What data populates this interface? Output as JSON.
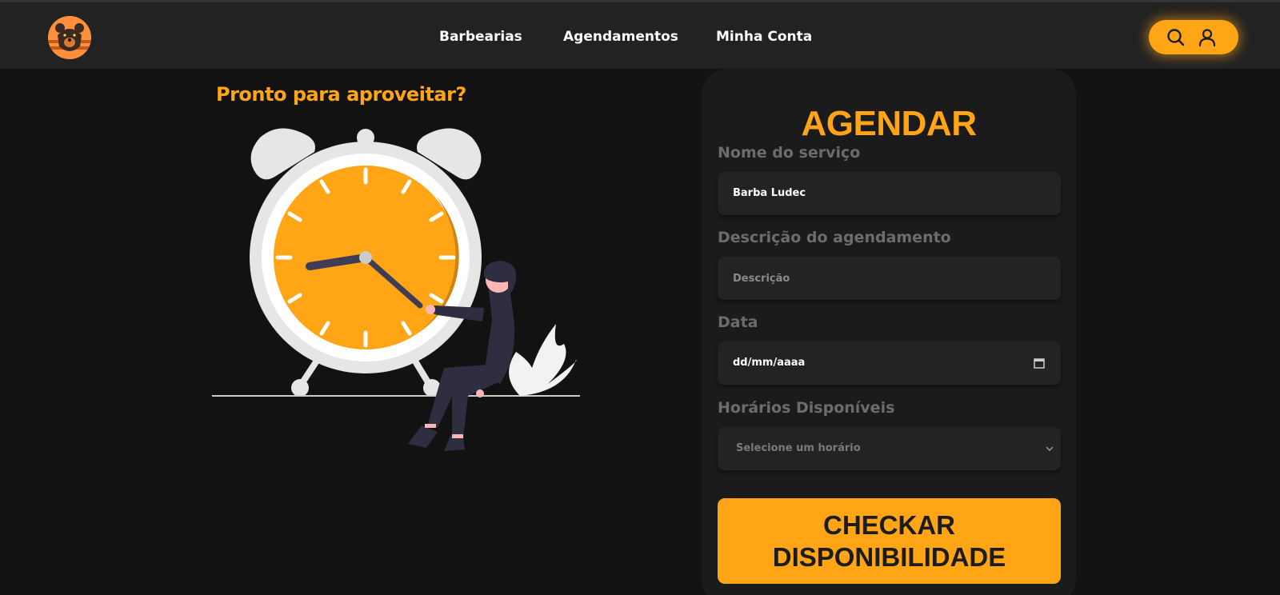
{
  "header": {
    "logo_icon": "bear-logo-icon",
    "nav": [
      {
        "label": "Barbearias"
      },
      {
        "label": "Agendamentos"
      },
      {
        "label": "Minha Conta"
      }
    ],
    "actions": {
      "search_icon": "search-icon",
      "user_icon": "user-icon"
    }
  },
  "promo": {
    "title": "Pronto para aproveitar?",
    "illustration_icon": "alarm-clock-illustration"
  },
  "form": {
    "title": "AGENDAR",
    "service_label": "Nome do serviço",
    "service_value": "Barba Ludec",
    "description_label": "Descrição do agendamento",
    "description_placeholder": "Descrição",
    "date_label": "Data",
    "date_placeholder": "dd/mm/aaaa",
    "times_label": "Horários Disponíveis",
    "times_selected": "Selecione um horário",
    "submit_label": "CHECKAR DISPONIBILIDADE"
  },
  "colors": {
    "accent": "#ffa516",
    "background": "#121212",
    "header": "#222222",
    "card": "#1b1b1b"
  }
}
